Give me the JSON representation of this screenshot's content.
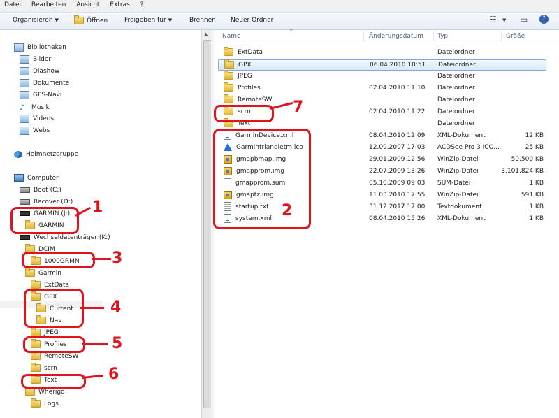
{
  "menu": [
    "Datei",
    "Bearbeiten",
    "Ansicht",
    "Extras",
    "?"
  ],
  "toolbar": {
    "organize": "Organisieren",
    "open": "Öffnen",
    "share": "Freigeben für",
    "burn": "Brennen",
    "new_folder": "Neuer Ordner"
  },
  "nav": {
    "libraries": "Bibliotheken",
    "lib_items": [
      "Bilder",
      "Diashow",
      "Dokumente",
      "GPS-Navi",
      "Musik",
      "Videos",
      "Webs"
    ],
    "homegroup": "Heimnetzgruppe",
    "computer": "Computer",
    "drives": [
      "Boot (C:)",
      "Recover (D:)",
      "GARMIN (J:)"
    ],
    "garmin_j_child": "GARMIN",
    "removable": "Wechseldatenträger (K:)",
    "dcim": "DCIM",
    "dcim_child": "1000GRMN",
    "garmin": "Garmin",
    "garmin_children": [
      "ExtData",
      "GPX"
    ],
    "gpx_children": [
      "Current",
      "Nav"
    ],
    "garmin_children_2": [
      "JPEG",
      "Profiles",
      "RemoteSW",
      "scrn",
      "Text"
    ],
    "wherigo": "Wherigo",
    "wherigo_child": "Logs"
  },
  "columns": {
    "name": "Name",
    "date": "Änderungsdatum",
    "type": "Typ",
    "size": "Größe"
  },
  "files": [
    {
      "name": "ExtData",
      "date": "",
      "type": "Dateiordner",
      "size": "",
      "icon": "folder"
    },
    {
      "name": "GPX",
      "date": "06.04.2010 10:51",
      "type": "Dateiordner",
      "size": "",
      "icon": "folder"
    },
    {
      "name": "JPEG",
      "date": "",
      "type": "Dateiordner",
      "size": "",
      "icon": "folder"
    },
    {
      "name": "Profiles",
      "date": "02.04.2010 11:10",
      "type": "Dateiordner",
      "size": "",
      "icon": "folder"
    },
    {
      "name": "RemoteSW",
      "date": "",
      "type": "Dateiordner",
      "size": "",
      "icon": "folder"
    },
    {
      "name": "scrn",
      "date": "02.04.2010 11:22",
      "type": "Dateiordner",
      "size": "",
      "icon": "folder"
    },
    {
      "name": "Text",
      "date": "",
      "type": "Dateiordner",
      "size": "",
      "icon": "folder"
    },
    {
      "name": "GarminDevice.xml",
      "date": "08.04.2010 12:09",
      "type": "XML-Dokument",
      "size": "12 KB",
      "icon": "xml"
    },
    {
      "name": "Garmintriangletm.ico",
      "date": "12.09.2007 17:03",
      "type": "ACDSee Pro 3 ICO...",
      "size": "25 KB",
      "icon": "ico"
    },
    {
      "name": "gmapbmap.img",
      "date": "29.01.2009 12:56",
      "type": "WinZip-Datei",
      "size": "50.500 KB",
      "icon": "zip"
    },
    {
      "name": "gmapprom.img",
      "date": "22.07.2009 13:26",
      "type": "WinZip-Datei",
      "size": "3.101.824 KB",
      "icon": "zip"
    },
    {
      "name": "gmapprom.sum",
      "date": "05.10.2009 09:03",
      "type": "SUM-Datei",
      "size": "1 KB",
      "icon": "sum"
    },
    {
      "name": "gmaptz.img",
      "date": "11.03.2010 17:55",
      "type": "WinZip-Datei",
      "size": "591 KB",
      "icon": "zip"
    },
    {
      "name": "startup.txt",
      "date": "31.12.2017 17:00",
      "type": "Textdokument",
      "size": "1 KB",
      "icon": "txt"
    },
    {
      "name": "system.xml",
      "date": "08.04.2010 15:26",
      "type": "XML-Dokument",
      "size": "1 KB",
      "icon": "xml"
    }
  ],
  "annotations": [
    "1",
    "2",
    "3",
    "4",
    "5",
    "6",
    "7"
  ],
  "colors": {
    "annotation": "#e0141e",
    "selection": "#d5e9f8"
  }
}
